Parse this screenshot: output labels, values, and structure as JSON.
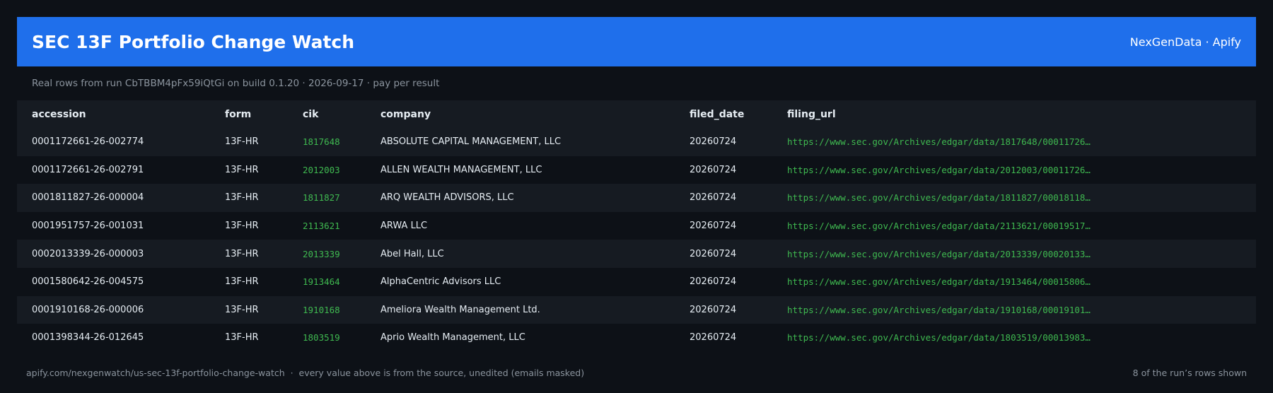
{
  "header": {
    "title": "SEC 13F Portfolio Change Watch",
    "brand": "NexGenData · Apify"
  },
  "subtitle": "Real rows from run CbTBBM4pFx59iQtGi on build 0.1.20 · 2026-09-17 · pay per result",
  "table": {
    "columns": [
      "accession",
      "form",
      "cik",
      "company",
      "filed_date",
      "filing_url"
    ],
    "rows": [
      [
        "0001172661-26-002774",
        "13F-HR",
        "1817648",
        "ABSOLUTE CAPITAL MANAGEMENT, LLC",
        "20260724",
        "https://www.sec.gov/Archives/edgar/data/1817648/00011726…"
      ],
      [
        "0001172661-26-002791",
        "13F-HR",
        "2012003",
        "ALLEN WEALTH MANAGEMENT, LLC",
        "20260724",
        "https://www.sec.gov/Archives/edgar/data/2012003/00011726…"
      ],
      [
        "0001811827-26-000004",
        "13F-HR",
        "1811827",
        "ARQ WEALTH ADVISORS, LLC",
        "20260724",
        "https://www.sec.gov/Archives/edgar/data/1811827/00018118…"
      ],
      [
        "0001951757-26-001031",
        "13F-HR",
        "2113621",
        "ARWA LLC",
        "20260724",
        "https://www.sec.gov/Archives/edgar/data/2113621/00019517…"
      ],
      [
        "0002013339-26-000003",
        "13F-HR",
        "2013339",
        "Abel Hall, LLC",
        "20260724",
        "https://www.sec.gov/Archives/edgar/data/2013339/00020133…"
      ],
      [
        "0001580642-26-004575",
        "13F-HR",
        "1913464",
        "AlphaCentric Advisors LLC",
        "20260724",
        "https://www.sec.gov/Archives/edgar/data/1913464/00015806…"
      ],
      [
        "0001910168-26-000006",
        "13F-HR",
        "1910168",
        "Ameliora Wealth Management Ltd.",
        "20260724",
        "https://www.sec.gov/Archives/edgar/data/1910168/00019101…"
      ],
      [
        "0001398344-26-012645",
        "13F-HR",
        "1803519",
        "Aprio Wealth Management, LLC",
        "20260724",
        "https://www.sec.gov/Archives/edgar/data/1803519/00013983…"
      ]
    ]
  },
  "footer": {
    "left": "apify.com/nexgenwatch/us-sec-13f-portfolio-change-watch  ·  every value above is from the source, unedited (emails masked)",
    "right": "8 of the run’s rows shown"
  },
  "colors": {
    "header_bg": "#1f6feb",
    "page_bg": "#0d1117",
    "row_alt_bg": "#161b22",
    "accent_green": "#3fb950",
    "muted_text": "#8b949e"
  }
}
